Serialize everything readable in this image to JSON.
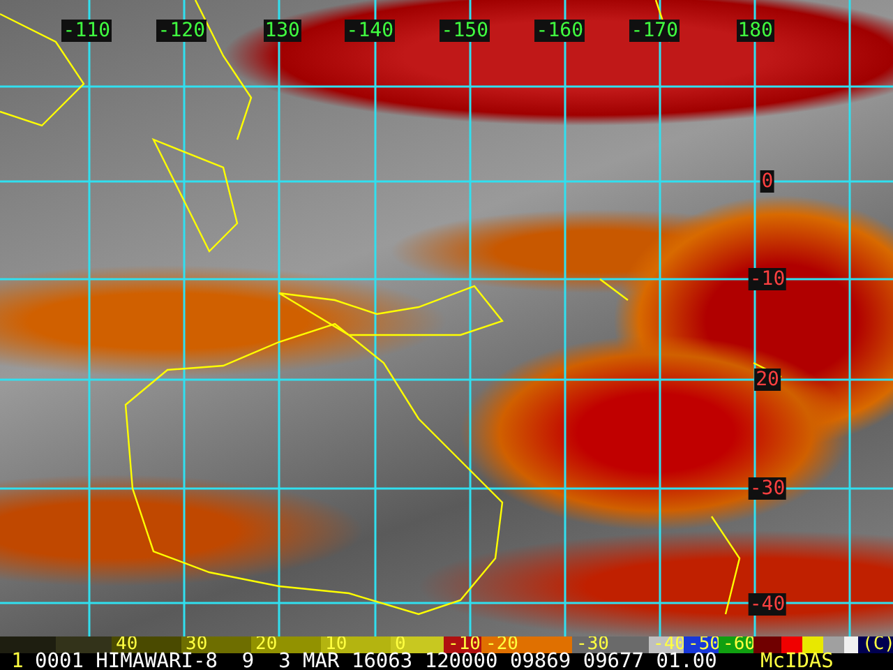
{
  "map": {
    "longitude_labels": [
      "-110",
      "-120",
      "130",
      "-140",
      "-150",
      "-160",
      "-170",
      "180"
    ],
    "latitude_labels": [
      "0",
      "-10",
      "20",
      "-30",
      "-40"
    ]
  },
  "color_bar": {
    "segments": [
      {
        "color": "#1e1e10"
      },
      {
        "color": "#33331a"
      },
      {
        "color": "#4a4a00",
        "label": "40"
      },
      {
        "color": "#6e6e00",
        "label": "30"
      },
      {
        "color": "#929200",
        "label": "20"
      },
      {
        "color": "#b4b410",
        "label": "10"
      },
      {
        "color": "#c8c820",
        "label": "0"
      },
      {
        "color": "#b01010",
        "label": "-10"
      },
      {
        "color": "#e07000",
        "label": "-20"
      },
      {
        "color": "#6a6a6a",
        "label": "-30"
      },
      {
        "color": "#c0c0c0",
        "label": "-40"
      },
      {
        "color": "#1838d8",
        "label": "-50"
      },
      {
        "color": "#10a010",
        "label": "-60"
      },
      {
        "color": "#700000"
      },
      {
        "color": "#f00000"
      },
      {
        "color": "#e8e800"
      },
      {
        "color": "#a0a0a0"
      },
      {
        "color": "#f0f0f0"
      },
      {
        "color": "#000050",
        "label": "(C)"
      }
    ]
  },
  "status_line": {
    "frame": "1",
    "info": "0001 HIMAWARI-8  9  3 MAR 16063 120000 09869 09677 01.00",
    "software": "McIDAS"
  }
}
